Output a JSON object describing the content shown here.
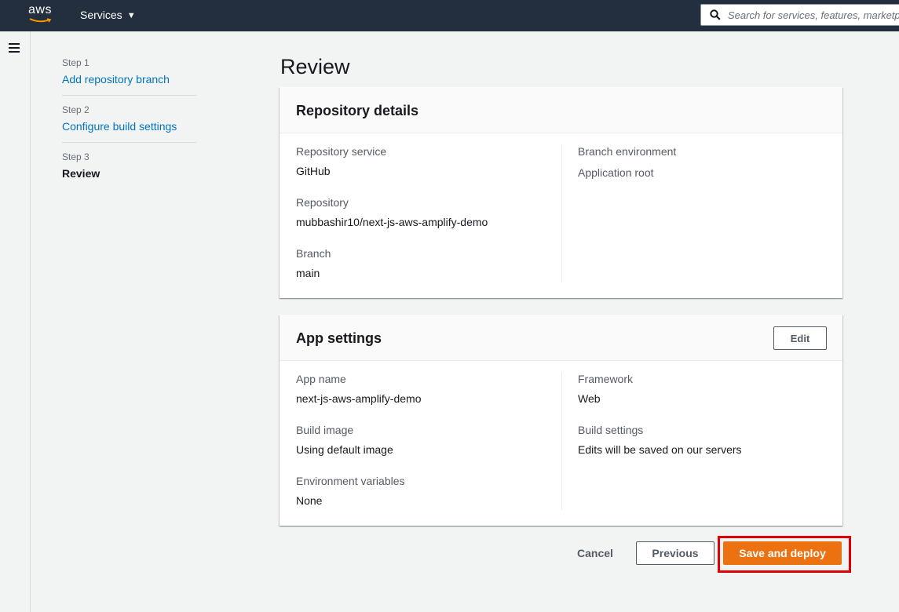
{
  "topbar": {
    "logo_text": "aws",
    "services_label": "Services",
    "search_placeholder": "Search for services, features, marketplace products, and docs"
  },
  "wizard": {
    "steps": [
      {
        "number": "Step 1",
        "label": "Add repository branch"
      },
      {
        "number": "Step 2",
        "label": "Configure build settings"
      },
      {
        "number": "Step 3",
        "label": "Review"
      }
    ],
    "current_step": 3
  },
  "page": {
    "title": "Review"
  },
  "repository_details": {
    "title": "Repository details",
    "left": [
      {
        "label": "Repository service",
        "value": "GitHub"
      },
      {
        "label": "Repository",
        "value": "mubbashir10/next-js-aws-amplify-demo"
      },
      {
        "label": "Branch",
        "value": "main"
      }
    ],
    "right": [
      {
        "label": "Branch environment",
        "value": ""
      },
      {
        "label": "Application root",
        "value": ""
      }
    ]
  },
  "app_settings": {
    "title": "App settings",
    "edit_label": "Edit",
    "left": [
      {
        "label": "App name",
        "value": "next-js-aws-amplify-demo"
      },
      {
        "label": "Build image",
        "value": "Using default image"
      },
      {
        "label": "Environment variables",
        "value": "None"
      }
    ],
    "right": [
      {
        "label": "Framework",
        "value": "Web"
      },
      {
        "label": "Build settings",
        "value": "Edits will be saved on our servers"
      }
    ]
  },
  "actions": {
    "cancel_label": "Cancel",
    "previous_label": "Previous",
    "deploy_label": "Save and deploy"
  },
  "colors": {
    "topbar": "#232f3e",
    "primary": "#ec7211",
    "link": "#0073bb",
    "highlight": "#e00000"
  }
}
